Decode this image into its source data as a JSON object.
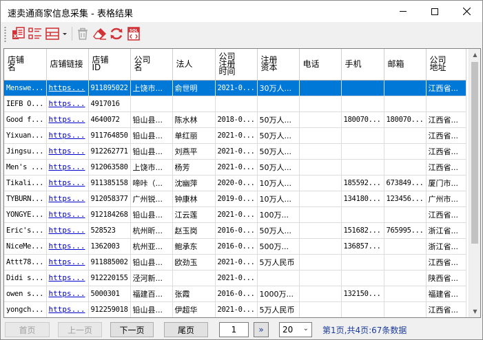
{
  "window": {
    "title": "速卖通商家信息采集 - 表格结果"
  },
  "toolbar": {
    "icons": [
      "export-excel-icon",
      "column-list-icon",
      "layout-icon",
      "dropdown-arrow-icon",
      "trash-icon",
      "eraser-icon",
      "refresh-icon",
      "sql-export-icon"
    ]
  },
  "table": {
    "columns": [
      "店铺名",
      "店铺链接",
      "店铺ID",
      "公司名",
      "法人",
      "公司注册时间",
      "注册资本",
      "电话",
      "手机",
      "邮箱",
      "公司地址"
    ],
    "column_lines": [
      [
        "店铺",
        "名"
      ],
      [
        "店铺链接"
      ],
      [
        "店铺",
        "ID"
      ],
      [
        "公司",
        "名"
      ],
      [
        "法人"
      ],
      [
        "公司",
        "注册",
        "时间"
      ],
      [
        "注册",
        "资本"
      ],
      [
        "电话"
      ],
      [
        "手机"
      ],
      [
        "邮箱"
      ],
      [
        "公司",
        "地址"
      ]
    ],
    "selected_row": 0,
    "rows": [
      [
        "Menswe...",
        "https...",
        "911895022",
        "上饶市...",
        "俞世明",
        "2021-0...",
        "30万人...",
        "",
        "",
        "",
        "江西省..."
      ],
      [
        "IEFB O...",
        "https...",
        "4917016",
        "",
        "",
        "",
        "",
        "",
        "",
        "",
        ""
      ],
      [
        "Good f...",
        "https...",
        "4640072",
        "铅山县...",
        "陈水林",
        "2018-0...",
        "50万人...",
        "",
        "180070...",
        "180070...",
        "江西省..."
      ],
      [
        "Yixuan...",
        "https...",
        "911764850",
        "铅山县...",
        "单红丽",
        "2021-0...",
        "50万人...",
        "",
        "",
        "",
        "江西省..."
      ],
      [
        "Jingsu...",
        "https...",
        "912262771",
        "铅山县...",
        "刘燕平",
        "2021-0...",
        "50万人...",
        "",
        "",
        "",
        "江西省..."
      ],
      [
        "Men's ...",
        "https...",
        "912063580",
        "上饶市...",
        "杨芳",
        "2021-0...",
        "50万人...",
        "",
        "",
        "",
        "江西省..."
      ],
      [
        "Tikali...",
        "https...",
        "911385158",
        "啼咔（...",
        "沈幽萍",
        "2020-0...",
        "10万人...",
        "",
        "185592...",
        "673849...",
        "厦门市..."
      ],
      [
        "TYBURN...",
        "https...",
        "912058377",
        "广州锐...",
        "钟康林",
        "2019-0...",
        "10万人...",
        "",
        "134180...",
        "123456...",
        "广州市..."
      ],
      [
        "YONGYE...",
        "https...",
        "912184268",
        "铅山县...",
        "江云莲",
        "2021-0...",
        "100万...",
        "",
        "",
        "",
        "江西省..."
      ],
      [
        "Eric's...",
        "https...",
        "528523",
        "杭州昕...",
        "赵玉岗",
        "2016-0...",
        "50万人...",
        "",
        "151682...",
        "765995...",
        "浙江省..."
      ],
      [
        "NiceMe...",
        "https...",
        "1362003",
        "杭州亚...",
        "鲍承东",
        "2016-0...",
        "500万...",
        "",
        "136857...",
        "",
        "浙江省..."
      ],
      [
        "Attt78...",
        "https...",
        "911885002",
        "铅山县...",
        "欧劲玉",
        "2021-0...",
        "5万人民币",
        "",
        "",
        "",
        "江西省..."
      ],
      [
        "Didi s...",
        "https...",
        "912220155",
        "泾河新...",
        "",
        "2021-0...",
        "",
        "",
        "",
        "",
        "陕西省..."
      ],
      [
        "owen s...",
        "https...",
        "5000301",
        "福建百...",
        "张霞",
        "2016-0...",
        "1000万...",
        "",
        "132150...",
        "",
        "福建省..."
      ],
      [
        "yongch...",
        "https...",
        "912259018",
        "铅山县...",
        "伊超华",
        "2021-0...",
        "5万人民币",
        "",
        "",
        "",
        "江西省..."
      ]
    ]
  },
  "pager": {
    "first_label": "首页",
    "prev_label": "上一页",
    "next_label": "下一页",
    "last_label": "尾页",
    "page_value": "1",
    "go_label": "»",
    "page_size": "20",
    "info": "第1页,共4页:67条数据"
  },
  "colors": {
    "selection": "#0078d7",
    "link": "#0000cc",
    "info_text": "#1a3a9a",
    "export_red": "#d13438"
  }
}
